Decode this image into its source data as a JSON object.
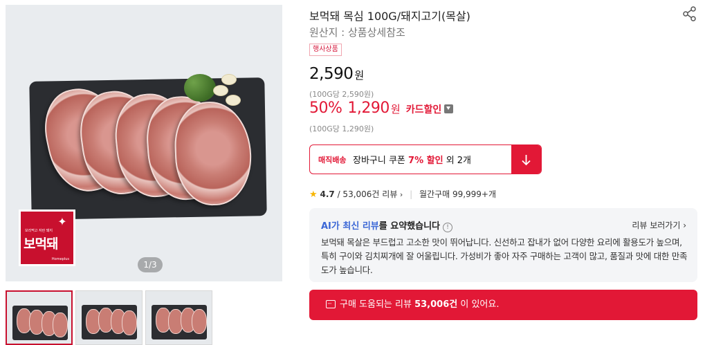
{
  "gallery": {
    "indicator_current": "1",
    "indicator_sep": "/",
    "indicator_total": "3",
    "logo_text": "보먹돼",
    "logo_sub": "보리먹고 자란 돼지",
    "logo_tiny": "Homeplus",
    "thumbnail_count": 3
  },
  "product": {
    "title": "보먹돼 목심 100G/돼지고기(목살)",
    "origin": "원산지 : 상품상세참조",
    "event_badge": "행사상품"
  },
  "price": {
    "regular": "2,590",
    "currency": "원",
    "unit_price": "(100G당 2,590원)",
    "discount_pct": "50%",
    "sale": "1,290",
    "sale_currency": "원",
    "card_discount_label": "카드할인",
    "sale_unit_price": "(100G당 1,290원)"
  },
  "coupon": {
    "tag": "매직배송",
    "text_prefix": "장바구니 쿠폰 ",
    "pct": "7% 할인",
    "text_suffix": " 외 2개"
  },
  "rating": {
    "star": "★",
    "score": "4.7",
    "reviews": "/ 53,006건 리뷰",
    "monthly": "월간구매 99,999+개"
  },
  "ai_summary": {
    "title_highlight": "AI가 최신 리뷰",
    "title_rest": "를 요약했습니다",
    "more_link": "리뷰 보러가기",
    "summary": "보먹돼 목살은 부드럽고 고소한 맛이 뛰어납니다. 신선하고 잡내가 없어 다양한 요리에 활용도가 높으며, 특히 구이와 김치찌개에 잘 어울립니다. 가성비가 좋아 자주 구매하는 고객이 많고, 품질과 맛에 대한 만족도가 높습니다."
  },
  "review_cta": {
    "prefix": "구매 도움되는 리뷰 ",
    "count": "53,006건",
    "suffix": " 이 있어요."
  },
  "colors": {
    "accent": "#e21836",
    "ai_blue": "#3b67d6",
    "star": "#f7b500"
  }
}
